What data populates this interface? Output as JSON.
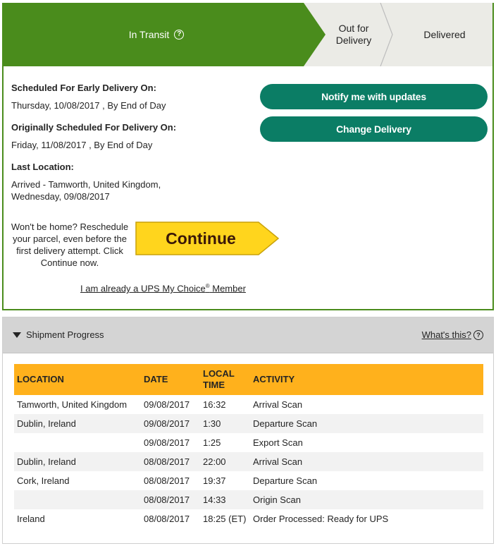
{
  "progress": {
    "steps": [
      {
        "label": "In Transit",
        "state": "current"
      },
      {
        "label": "Out for Delivery",
        "line1": "Out for",
        "line2": "Delivery",
        "state": "pending"
      },
      {
        "label": "Delivered",
        "state": "pending"
      }
    ],
    "help_icon": "?"
  },
  "delivery": {
    "early_label": "Scheduled For Early Delivery On:",
    "early_value": "Thursday, 10/08/2017 , By End of Day",
    "original_label": "Originally Scheduled For Delivery On:",
    "original_value": "Friday, 11/08/2017 , By End of Day",
    "last_location_label": "Last Location:",
    "last_location_line1": "Arrived - Tamworth, United Kingdom,",
    "last_location_line2": "Wednesday, 09/08/2017"
  },
  "actions": {
    "notify_label": "Notify me with updates",
    "change_label": "Change Delivery",
    "wont_home_text": "Won't be home? Reschedule your parcel, even before the first delivery attempt. Click Continue now.",
    "continue_label": "Continue",
    "member_link_text": "I am already a UPS My Choice",
    "member_link_mark": "®",
    "member_link_suffix": " Member"
  },
  "shipment_progress": {
    "title": "Shipment Progress",
    "whats_this": "What's this?",
    "columns": [
      "LOCATION",
      "DATE",
      "LOCAL TIME",
      "ACTIVITY"
    ],
    "rows": [
      {
        "location": "Tamworth, United Kingdom",
        "date": "09/08/2017",
        "time": "16:32",
        "activity": "Arrival Scan"
      },
      {
        "location": "Dublin, Ireland",
        "date": "09/08/2017",
        "time": "1:30",
        "activity": "Departure Scan"
      },
      {
        "location": "",
        "date": "09/08/2017",
        "time": "1:25",
        "activity": "Export Scan"
      },
      {
        "location": "Dublin, Ireland",
        "date": "08/08/2017",
        "time": "22:00",
        "activity": "Arrival Scan"
      },
      {
        "location": "Cork, Ireland",
        "date": "08/08/2017",
        "time": "19:37",
        "activity": "Departure Scan"
      },
      {
        "location": "",
        "date": "08/08/2017",
        "time": "14:33",
        "activity": "Origin Scan"
      },
      {
        "location": "Ireland",
        "date": "08/08/2017",
        "time": "18:25 (ET)",
        "activity": "Order Processed: Ready for UPS"
      }
    ]
  },
  "colors": {
    "transit_green": "#4a8c1c",
    "pending_gray": "#ebebe6",
    "button_teal": "#0b7d65",
    "continue_yellow": "#ffd51d",
    "table_header_orange": "#ffb11c"
  }
}
